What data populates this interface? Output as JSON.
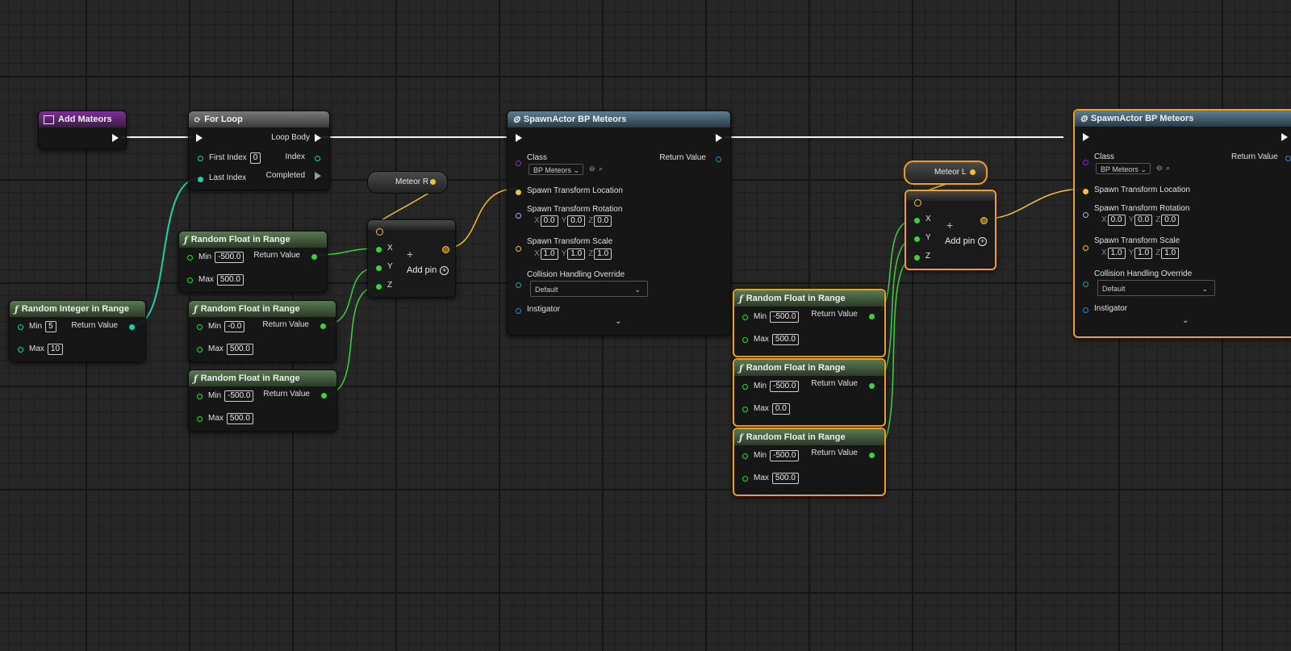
{
  "colors": {
    "exec": "#f4f4f4",
    "int": "#1fd1a8",
    "float": "#3ad43a",
    "vector": "#f3c230",
    "object": "#1e90d8",
    "class": "#8a2fd6",
    "rotator": "#9ab4ff",
    "collision": "#27a0a0",
    "selection": "#f2a019"
  },
  "add_mateors": {
    "title": "Add Mateors"
  },
  "for_loop": {
    "title": "For Loop",
    "loop_body": "Loop Body",
    "first_index": "First Index",
    "first_index_value": "0",
    "index": "Index",
    "last_index": "Last Index",
    "completed": "Completed"
  },
  "rand_int": {
    "title": "Random Integer in Range",
    "min_label": "Min",
    "min_value": "5",
    "max_label": "Max",
    "max_value": "10",
    "return": "Return Value"
  },
  "rf_left": [
    {
      "title": "Random Float in Range",
      "min_label": "Min",
      "min_value": "-500.0",
      "max_label": "Max",
      "max_value": "500.0",
      "return": "Return Value"
    },
    {
      "title": "Random Float in Range",
      "min_label": "Min",
      "min_value": "-0.0",
      "max_label": "Max",
      "max_value": "500.0",
      "return": "Return Value"
    },
    {
      "title": "Random Float in Range",
      "min_label": "Min",
      "min_value": "-500.0",
      "max_label": "Max",
      "max_value": "500.0",
      "return": "Return Value"
    }
  ],
  "meteor_r": {
    "label": "Meteor R"
  },
  "meteor_l": {
    "label": "Meteor L"
  },
  "make_vec": {
    "x": "X",
    "y": "Y",
    "z": "Z",
    "add_pin": "Add pin"
  },
  "spawn1": {
    "title": "SpawnActor BP Meteors",
    "class_label": "Class",
    "class_value": "BP Meteors",
    "return": "Return Value",
    "location": "Spawn Transform Location",
    "rotation": "Spawn Transform Rotation",
    "rot_x": "0.0",
    "rot_y": "0.0",
    "rot_z": "0.0",
    "scale": "Spawn Transform Scale",
    "scale_x": "1.0",
    "scale_y": "1.0",
    "scale_z": "1.0",
    "collision": "Collision Handling Override",
    "collision_value": "Default",
    "instigator": "Instigator",
    "axis_x": "X",
    "axis_y": "Y",
    "axis_z": "Z"
  },
  "rf_right": [
    {
      "title": "Random Float in Range",
      "min_label": "Min",
      "min_value": "-500.0",
      "max_label": "Max",
      "max_value": "500.0",
      "return": "Return Value"
    },
    {
      "title": "Random Float in Range",
      "min_label": "Min",
      "min_value": "-500.0",
      "max_label": "Max",
      "max_value": "0.0",
      "return": "Return Value"
    },
    {
      "title": "Random Float in Range",
      "min_label": "Min",
      "min_value": "-500.0",
      "max_label": "Max",
      "max_value": "500.0",
      "return": "Return Value"
    }
  ],
  "spawn2": {
    "title": "SpawnActor BP Meteors",
    "class_label": "Class",
    "class_value": "BP Meteors",
    "return": "Return Value",
    "location": "Spawn Transform Location",
    "rotation": "Spawn Transform Rotation",
    "rot_x": "0.0",
    "rot_y": "0.0",
    "rot_z": "0.0",
    "scale": "Spawn Transform Scale",
    "scale_x": "1.0",
    "scale_y": "1.0",
    "scale_z": "1.0",
    "collision": "Collision Handling Override",
    "collision_value": "Default",
    "instigator": "Instigator",
    "axis_x": "X",
    "axis_y": "Y",
    "axis_z": "Z"
  }
}
